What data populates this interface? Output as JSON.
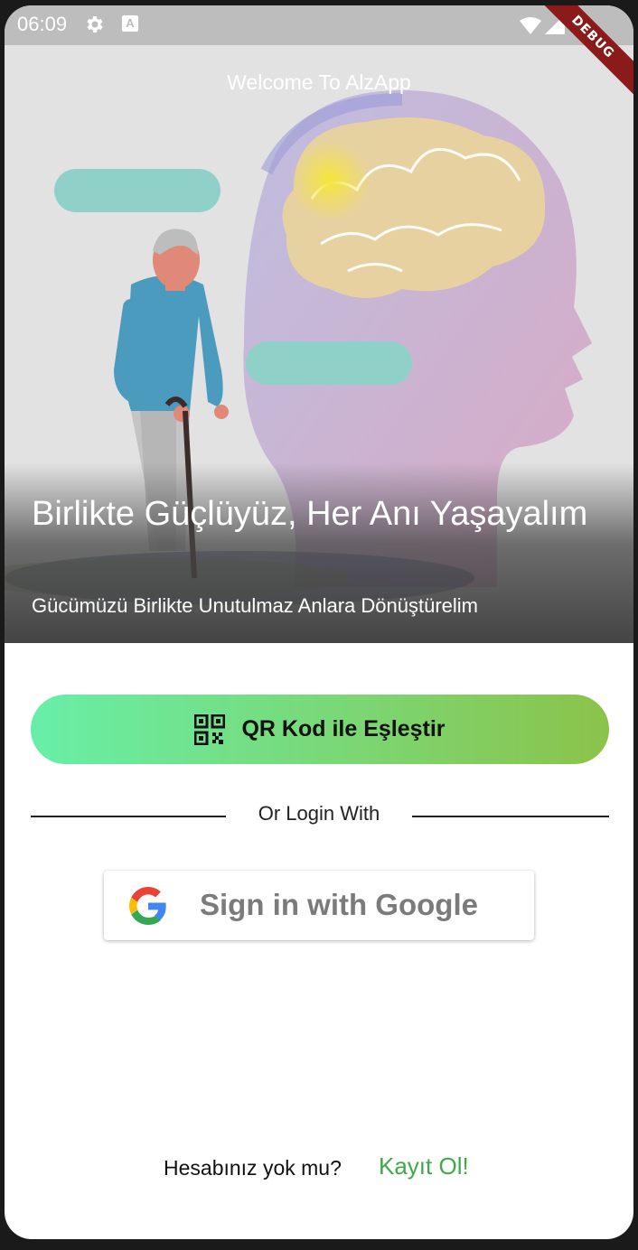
{
  "status_bar": {
    "time": "06:09",
    "icons": [
      "gear-icon",
      "a-badge-icon",
      "wifi-icon",
      "signal-icon",
      "battery-icon"
    ],
    "debug_label": "DEBUG"
  },
  "hero": {
    "welcome": "Welcome To AlzApp",
    "title": "Birlikte Güçlüyüz, Her Anı Yaşayalım",
    "subtitle": "Gücümüzü Birlikte Unutulmaz Anlara Dönüştürelim",
    "illustration": "elderly-man-with-cane-and-brain-profile"
  },
  "qr_button": {
    "label": "QR Kod ile Eşleştir",
    "icon": "qr-code-icon",
    "gradient": [
      "#67efa8",
      "#8bc34a"
    ]
  },
  "divider": {
    "label": "Or Login With"
  },
  "google_button": {
    "label": "Sign in with Google",
    "icon": "google-logo-icon"
  },
  "footer": {
    "question": "Hesabınız yok mu?",
    "register_link": "Kayıt Ol!",
    "link_color": "#3fa94a"
  }
}
